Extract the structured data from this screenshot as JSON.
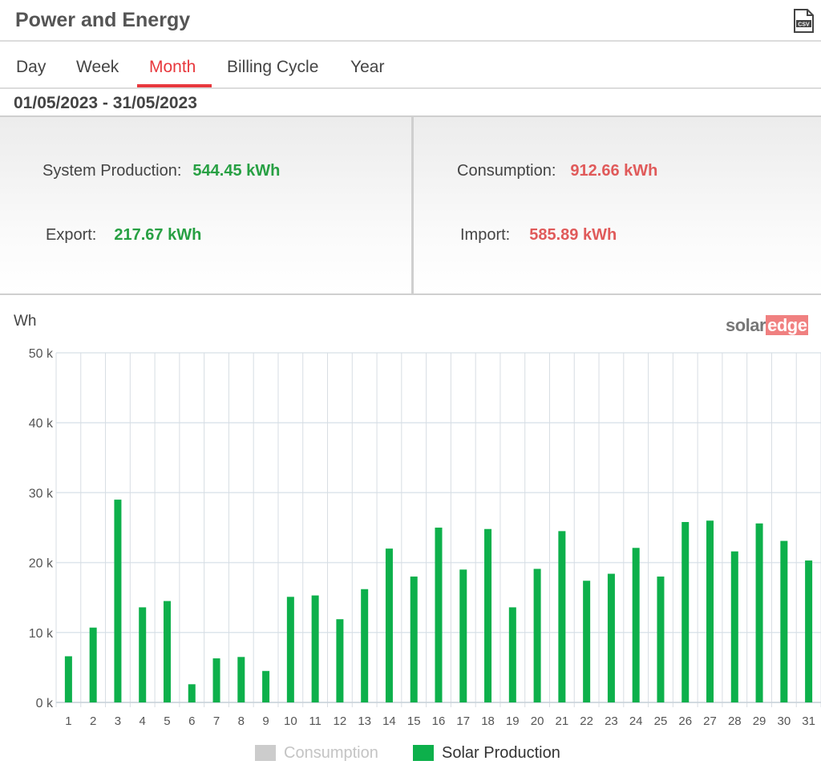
{
  "header": {
    "title": "Power and Energy",
    "csv_icon": "csv-file-icon"
  },
  "tabs": [
    {
      "label": "Day",
      "active": false
    },
    {
      "label": "Week",
      "active": false
    },
    {
      "label": "Month",
      "active": true
    },
    {
      "label": "Billing Cycle",
      "active": false
    },
    {
      "label": "Year",
      "active": false
    }
  ],
  "date_range": "01/05/2023 - 31/05/2023",
  "stats": {
    "system_production": {
      "label": "System Production:",
      "value": "544.45 kWh"
    },
    "consumption": {
      "label": "Consumption:",
      "value": "912.66 kWh"
    },
    "export": {
      "label": "Export:",
      "value": "217.67 kWh"
    },
    "import": {
      "label": "Import:",
      "value": "585.89 kWh"
    }
  },
  "colors": {
    "accent": "#e8383d",
    "positive": "#27a043",
    "negative": "#e05a5a",
    "bar": "#0db04b",
    "consumption_legend": "#cccccc"
  },
  "logo": {
    "part1": "solar",
    "part2": "edge"
  },
  "chart_data": {
    "type": "bar",
    "ylabel": "Wh",
    "ylim": [
      0,
      50000
    ],
    "yticks": [
      0,
      10000,
      20000,
      30000,
      40000,
      50000
    ],
    "ytick_labels": [
      "0 k",
      "10 k",
      "20 k",
      "30 k",
      "40 k",
      "50 k"
    ],
    "grid": true,
    "legend_position": "bottom",
    "categories": [
      "1",
      "2",
      "3",
      "4",
      "5",
      "6",
      "7",
      "8",
      "9",
      "10",
      "11",
      "12",
      "13",
      "14",
      "15",
      "16",
      "17",
      "18",
      "19",
      "20",
      "21",
      "22",
      "23",
      "24",
      "25",
      "26",
      "27",
      "28",
      "29",
      "30",
      "31"
    ],
    "series": [
      {
        "name": "Consumption",
        "color": "#cccccc",
        "visible": false,
        "values": []
      },
      {
        "name": "Solar Production",
        "color": "#0db04b",
        "visible": true,
        "values": [
          6600,
          10700,
          29000,
          13600,
          14500,
          2600,
          6300,
          6500,
          4500,
          15100,
          15300,
          11900,
          16200,
          22000,
          18000,
          25000,
          19000,
          24800,
          13600,
          19100,
          24500,
          17400,
          18400,
          22100,
          18000,
          25800,
          26000,
          21600,
          25600,
          23100,
          20300
        ]
      }
    ]
  }
}
